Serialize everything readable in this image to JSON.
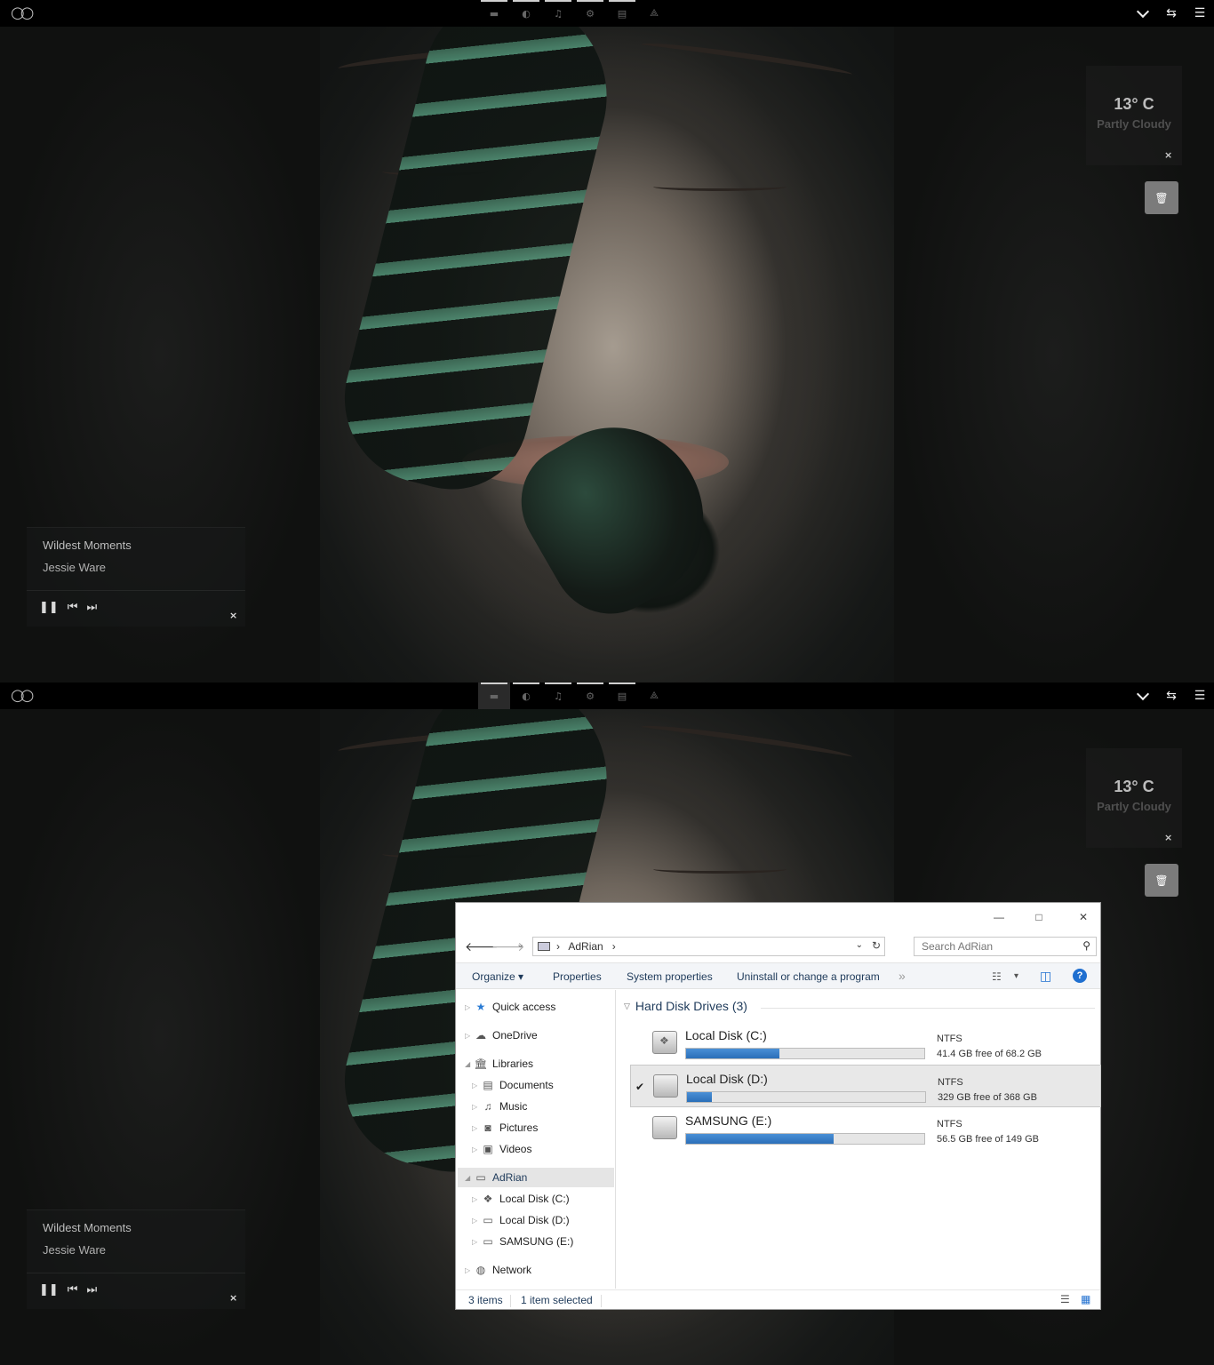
{
  "desktop": {
    "weather": {
      "temp": "13° C",
      "condition": "Partly Cloudy",
      "close": "×"
    },
    "music": {
      "song": "Wildest Moments",
      "artist": "Jessie Ware",
      "pause": "❚❚",
      "prev": "⏮",
      "next": "⏭",
      "close": "×"
    },
    "dock": [
      "folder-icon",
      "settings-icon",
      "music-icon",
      "gear-icon",
      "document-icon",
      "app-icon"
    ],
    "tray": [
      "chevron-down-icon",
      "network-icon",
      "action-center-icon"
    ]
  },
  "explorer": {
    "title_buttons": {
      "minimize": "—",
      "maximize": "□",
      "close": "✕"
    },
    "nav": {
      "back": "🡐",
      "forward": "🡒",
      "recent": "⌄"
    },
    "address": {
      "separator1": "›",
      "location": "AdRian",
      "separator2": "›",
      "dropdown": "⌄",
      "refresh": "↻"
    },
    "search": {
      "placeholder": "Search AdRian",
      "icon": "⚲"
    },
    "commands": {
      "organize": "Organize ▾",
      "properties": "Properties",
      "system_properties": "System properties",
      "uninstall": "Uninstall or change a program",
      "more": "»",
      "view": "☷",
      "view_dd": "▾",
      "pane": "◫",
      "help": "?"
    },
    "nav_pane": [
      {
        "label": "Quick access",
        "icon": "star-icon",
        "glyph": "★"
      },
      {
        "label": "OneDrive",
        "icon": "cloud-icon",
        "glyph": "☁"
      },
      {
        "label": "Libraries",
        "icon": "library-icon",
        "glyph": "🏛"
      },
      {
        "label": "Documents",
        "icon": "documents-icon",
        "glyph": "▤"
      },
      {
        "label": "Music",
        "icon": "music-folder-icon",
        "glyph": "♫"
      },
      {
        "label": "Pictures",
        "icon": "pictures-icon",
        "glyph": "◙"
      },
      {
        "label": "Videos",
        "icon": "videos-icon",
        "glyph": "▣"
      },
      {
        "label": "AdRian",
        "icon": "computer-icon",
        "glyph": "▭"
      },
      {
        "label": "Local Disk (C:)",
        "icon": "drive-icon",
        "glyph": "❖"
      },
      {
        "label": "Local Disk (D:)",
        "icon": "drive-icon",
        "glyph": "▭"
      },
      {
        "label": "SAMSUNG (E:)",
        "icon": "drive-icon",
        "glyph": "▭"
      },
      {
        "label": "Network",
        "icon": "network-icon",
        "glyph": "◍"
      }
    ],
    "group": {
      "title": "Hard Disk Drives (3)"
    },
    "drives": [
      {
        "name": "Local Disk (C:)",
        "fs": "NTFS",
        "free": "41.4 GB free of 68.2 GB",
        "used_fraction": 0.393,
        "selected": false
      },
      {
        "name": "Local Disk (D:)",
        "fs": "NTFS",
        "free": "329 GB free of 368 GB",
        "used_fraction": 0.106,
        "selected": true
      },
      {
        "name": "SAMSUNG (E:)",
        "fs": "NTFS",
        "free": "56.5 GB free of 149 GB",
        "used_fraction": 0.621,
        "selected": false
      }
    ],
    "status": {
      "items": "3 items",
      "selected": "1 item selected",
      "details_view": "☰",
      "tiles_view": "▦"
    }
  },
  "colors": {
    "accent_bar": "#2b6fb8",
    "help_blue": "#1f6fd0",
    "link_text": "#1e3a5a"
  }
}
